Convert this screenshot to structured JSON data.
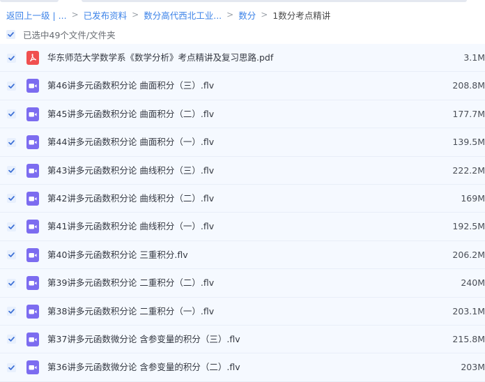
{
  "colors": {
    "accent": "#3b82e8",
    "checkbox_bg": "#e8f0fd",
    "checkbox_check": "#3b6fd6",
    "row_bg": "#f5f9ff",
    "pdf_icon": "#f05050",
    "video_icon": "#7c6cf0"
  },
  "breadcrumb": {
    "items": [
      {
        "label": "返回上一级 | ..."
      },
      {
        "label": "已发布资料"
      },
      {
        "label": "数分高代西北工业..."
      },
      {
        "label": "数分"
      },
      {
        "label": "1数分考点精讲"
      }
    ],
    "separator": ">"
  },
  "selection": {
    "label": "已选中49个文件/文件夹"
  },
  "files": [
    {
      "name": "华东师范大学数学系《数学分析》考点精讲及复习思路.pdf",
      "size": "3.1M",
      "icon": "pdf-icon"
    },
    {
      "name": "第46讲多元函数积分论 曲面积分（三）.flv",
      "size": "208.8M",
      "icon": "video-icon"
    },
    {
      "name": "第45讲多元函数积分论 曲面积分（二）.flv",
      "size": "177.7M",
      "icon": "video-icon"
    },
    {
      "name": "第44讲多元函数积分论 曲面积分（一）.flv",
      "size": "139.5M",
      "icon": "video-icon"
    },
    {
      "name": "第43讲多元函数积分论 曲线积分（三）.flv",
      "size": "222.2M",
      "icon": "video-icon"
    },
    {
      "name": "第42讲多元函数积分论 曲线积分（二）.flv",
      "size": "169M",
      "icon": "video-icon"
    },
    {
      "name": "第41讲多元函数积分论 曲线积分（一）.flv",
      "size": "192.5M",
      "icon": "video-icon"
    },
    {
      "name": "第40讲多元函数积分论 三重积分.flv",
      "size": "206.2M",
      "icon": "video-icon"
    },
    {
      "name": "第39讲多元函数积分论 二重积分（二）.flv",
      "size": "240M",
      "icon": "video-icon"
    },
    {
      "name": "第38讲多元函数积分论 二重积分（一）.flv",
      "size": "203.1M",
      "icon": "video-icon"
    },
    {
      "name": "第37讲多元函数微分论 含参变量的积分（三）.flv",
      "size": "215.8M",
      "icon": "video-icon"
    },
    {
      "name": "第36讲多元函数微分论 含参变量的积分（二）.flv",
      "size": "203M",
      "icon": "video-icon"
    }
  ]
}
